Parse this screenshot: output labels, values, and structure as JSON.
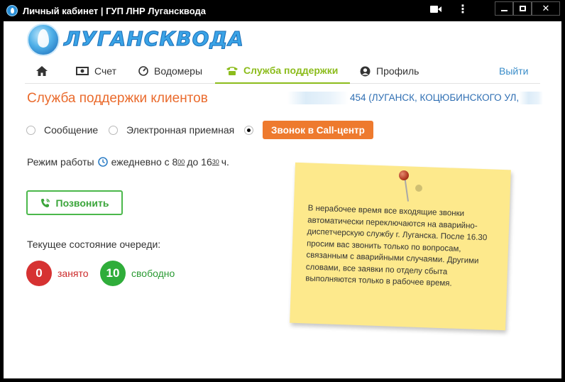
{
  "window": {
    "title": "Личный кабинет | ГУП ЛНР Лугансквода",
    "more_glyph": "⋮",
    "close_glyph": "✕"
  },
  "logo": {
    "text": "ЛУГАНСКВОДА"
  },
  "nav": {
    "bill": "Счет",
    "meters": "Водомеры",
    "support": "Служба поддержки",
    "profile": "Профиль",
    "logout": "Выйти"
  },
  "page": {
    "title": "Служба поддержки клиентов",
    "address": "454 (ЛУГАНСК, КОЦЮБИНСКОГО УЛ, 27,"
  },
  "contact_options": {
    "message": "Сообщение",
    "reception": "Электронная приемная",
    "call_center": "Звонок в Call-центр",
    "selected": "call_center"
  },
  "hours": {
    "prefix": "Режим работы",
    "daily": "ежедневно с 8",
    "start_min": "00",
    "to": "до 16",
    "end_min": "30",
    "suffix": "ч."
  },
  "dial_button": "Позвонить",
  "queue": {
    "label": "Текущее состояние очереди:",
    "busy_count": "0",
    "busy_label": "занято",
    "free_count": "10",
    "free_label": "свободно"
  },
  "note": {
    "text": "В нерабочее время все входящие звонки автоматически переключаются на аварийно-диспетчерскую службу г. Луганска. После 16.30 просим вас звонить только по вопросам, связанным с аварийными случаями. Другими словами, все заявки по отделу сбыта выполняются только в рабочее время."
  },
  "colors": {
    "accent_orange": "#ee7a2e",
    "active_tab_green": "#8cbc1c",
    "link_blue": "#3a8dc9",
    "busy_red": "#d63232",
    "free_green": "#2fad3a",
    "note_yellow": "#fde98c"
  }
}
